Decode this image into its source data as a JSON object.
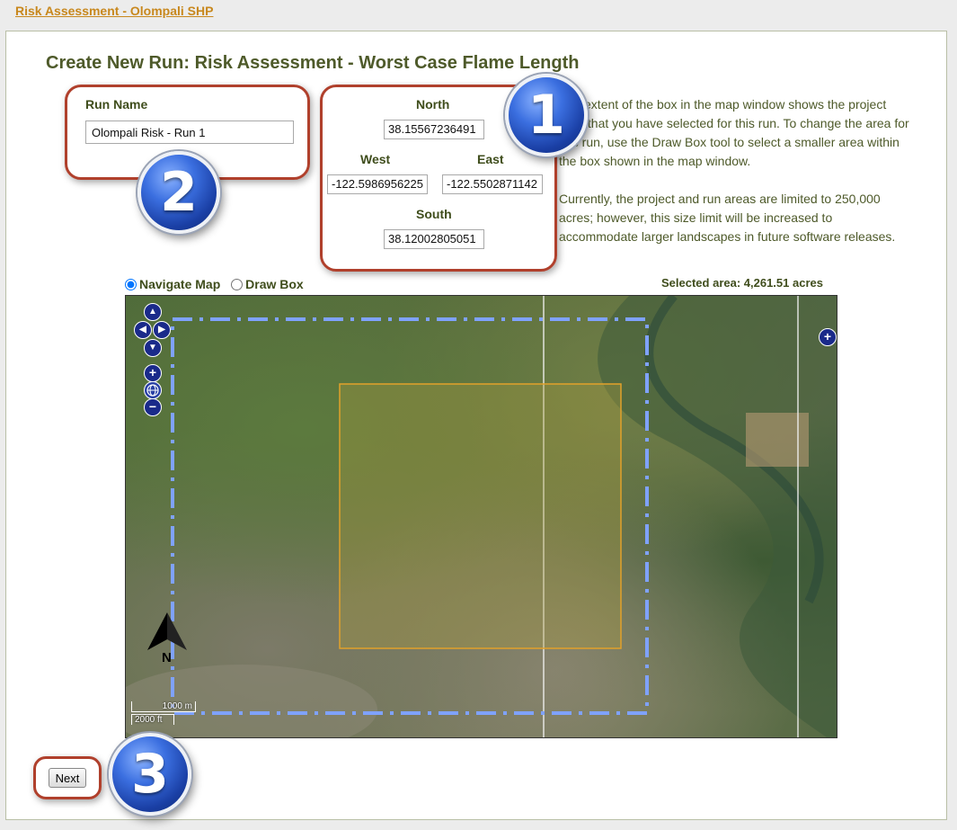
{
  "breadcrumb": "Risk Assessment - Olompali SHP",
  "page_title": "Create New Run: Risk Assessment - Worst Case Flame Length",
  "run_name": {
    "label": "Run Name",
    "value": "Olompali Risk - Run 1"
  },
  "extent": {
    "north_label": "North",
    "north_value": "38.15567236491",
    "west_label": "West",
    "west_value": "-122.5986956225",
    "east_label": "East",
    "east_value": "-122.5502871142",
    "south_label": "South",
    "south_value": "38.12002805051"
  },
  "info": {
    "p1": "The extent of the box in the map window shows the project area that you have selected for this run. To change the area for this run, use the Draw Box tool to select a smaller area within the box shown in the map window.",
    "p2": "Currently, the project and run areas are limited to 250,000 acres; however, this size limit will be increased to accommodate larger landscapes in future software releases."
  },
  "map_mode": {
    "navigate_label": "Navigate Map",
    "draw_label": "Draw Box",
    "selected": "navigate"
  },
  "selected_area": "Selected area: 4,261.51 acres",
  "map": {
    "north_arrow_label": "N",
    "scale_metric": "1000 m",
    "scale_imperial": "2000 ft",
    "zoom_in": "+",
    "zoom_out": "−",
    "pan_up": "▲",
    "pan_down": "▼",
    "pan_left": "◀",
    "pan_right": "▶",
    "layer_switcher": "+"
  },
  "badges": {
    "one": "1",
    "two": "2",
    "three": "3"
  },
  "next_label": "Next",
  "colors": {
    "accent_orange": "#c8881e",
    "callout_red": "#b0402c",
    "badge_blue": "#3b6fe0",
    "title_green": "#4e5a2a"
  }
}
